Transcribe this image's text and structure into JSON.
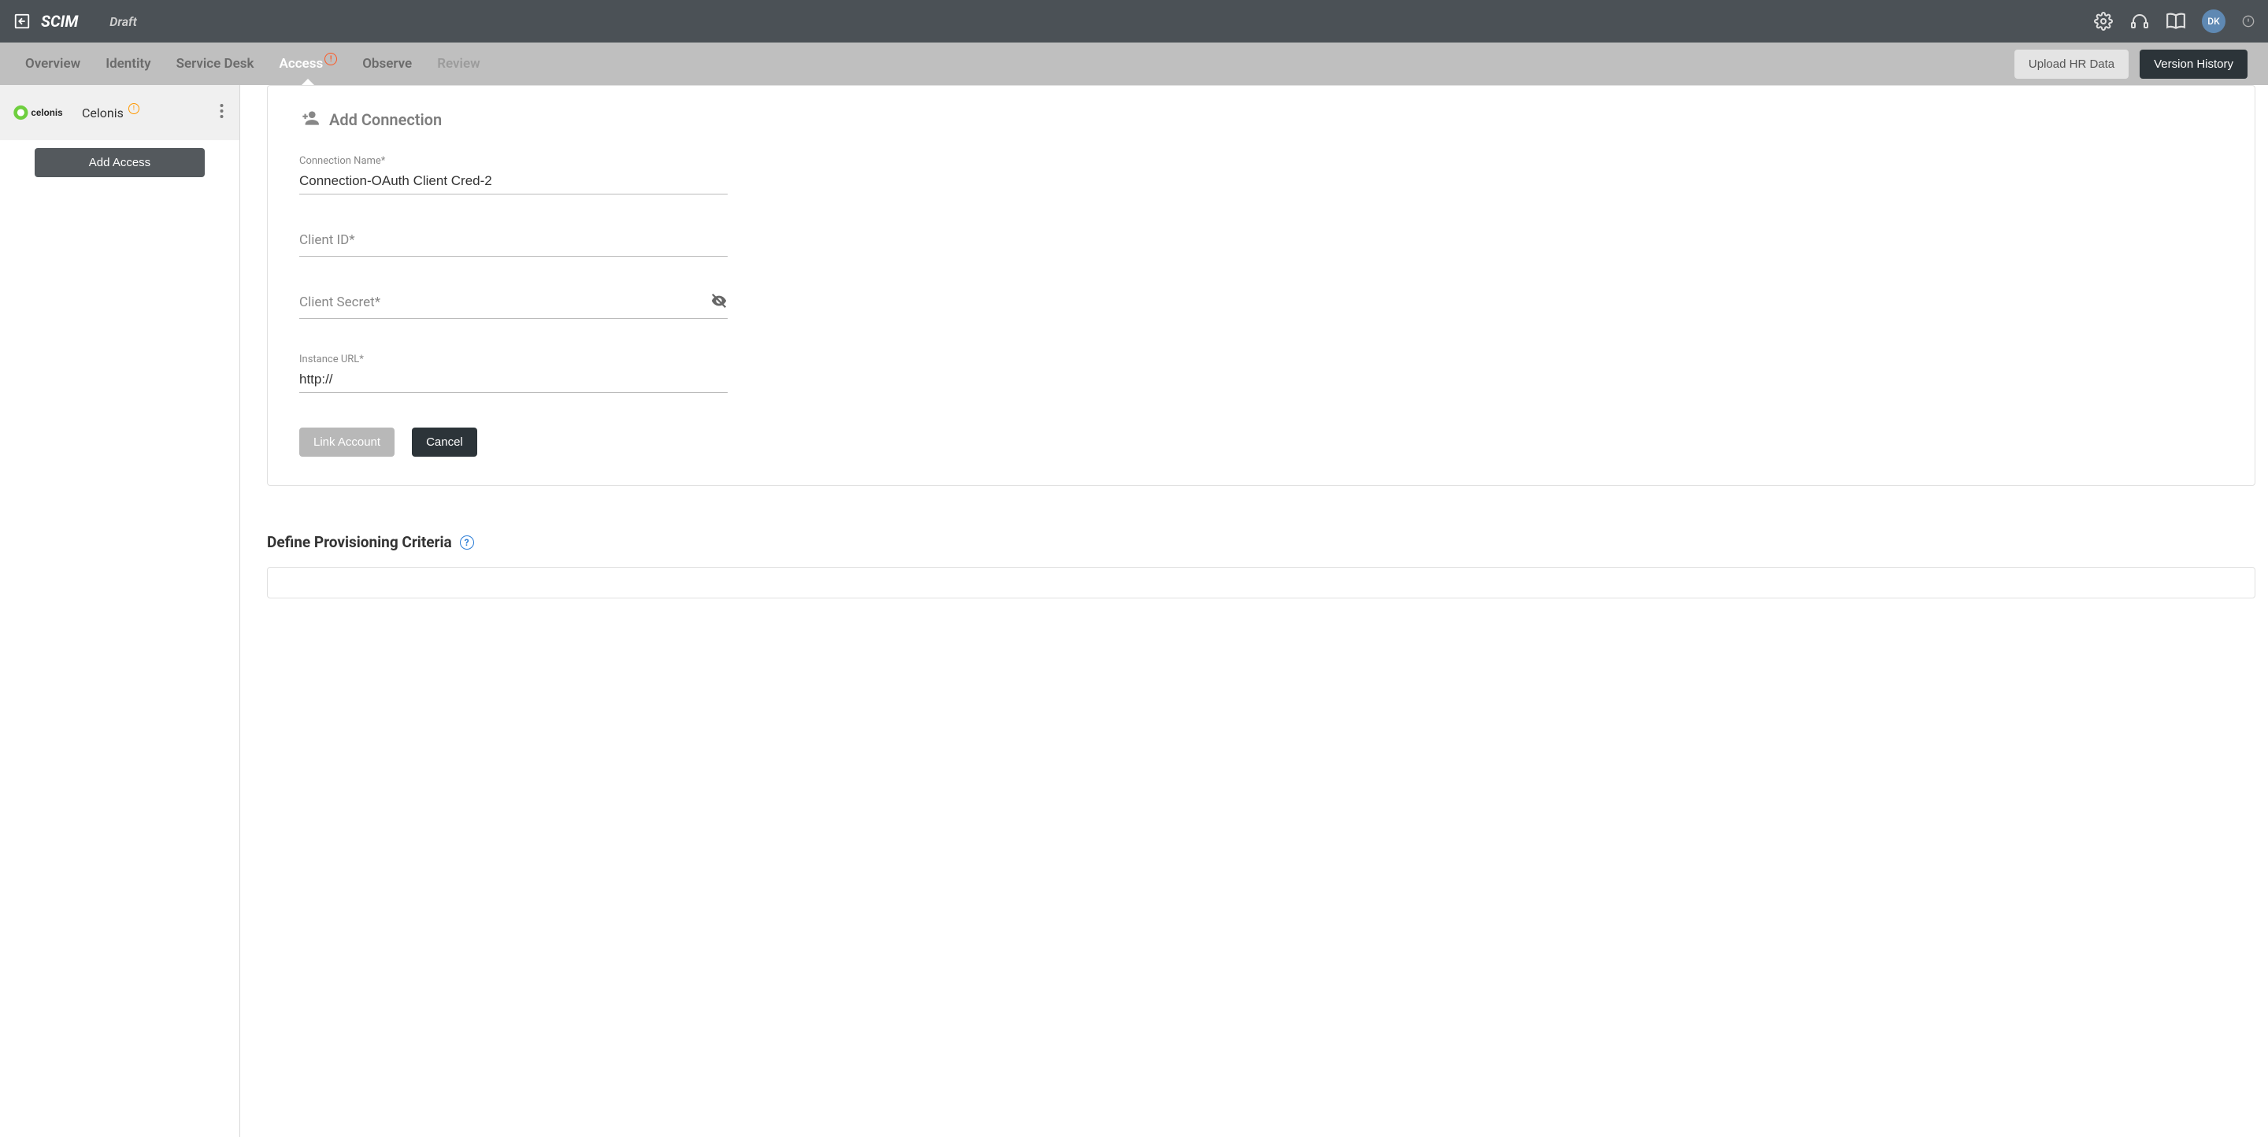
{
  "header": {
    "title": "SCIM",
    "status": "Draft",
    "avatar_initials": "DK"
  },
  "nav": {
    "tabs": [
      {
        "label": "Overview"
      },
      {
        "label": "Identity"
      },
      {
        "label": "Service Desk"
      },
      {
        "label": "Access"
      },
      {
        "label": "Observe"
      },
      {
        "label": "Review"
      }
    ],
    "badge_text": "!",
    "upload_btn": "Upload HR Data",
    "version_btn": "Version History"
  },
  "sidebar": {
    "item_label": "Celonis",
    "warn_text": "!",
    "add_access": "Add Access"
  },
  "form": {
    "card_title": "Add Connection",
    "conn_name_label": "Connection Name*",
    "conn_name_value": "Connection-OAuth Client Cred-2",
    "client_id_label": "Client ID*",
    "client_secret_label": "Client Secret*",
    "instance_url_label": "Instance URL*",
    "instance_url_value": "http://",
    "link_btn": "Link Account",
    "cancel_btn": "Cancel"
  },
  "provisioning": {
    "heading": "Define Provisioning Criteria",
    "help": "?"
  }
}
